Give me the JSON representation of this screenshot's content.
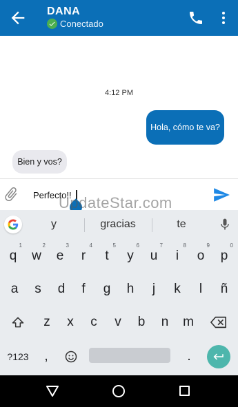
{
  "header": {
    "contact_name": "DANA",
    "status": "Conectado",
    "icons": [
      "back-arrow-icon",
      "phone-icon",
      "more-vertical-icon",
      "check-circle-icon"
    ],
    "bar_color": "#0b6fb7"
  },
  "chat": {
    "timestamp": "4:12 PM",
    "messages": [
      {
        "direction": "outgoing",
        "text": "Hola, cómo te va?"
      },
      {
        "direction": "incoming",
        "text": "Bien y vos?"
      }
    ]
  },
  "composer": {
    "value": "Perfecto!!",
    "icons": [
      "paperclip-icon",
      "send-icon"
    ]
  },
  "watermark": "UpdateStar.com",
  "keyboard": {
    "suggestions": [
      "y",
      "gracias",
      "te"
    ],
    "row1": [
      {
        "key": "q",
        "hint": "1"
      },
      {
        "key": "w",
        "hint": "2"
      },
      {
        "key": "e",
        "hint": "3"
      },
      {
        "key": "r",
        "hint": "4"
      },
      {
        "key": "t",
        "hint": "5"
      },
      {
        "key": "y",
        "hint": "6"
      },
      {
        "key": "u",
        "hint": "7"
      },
      {
        "key": "i",
        "hint": "8"
      },
      {
        "key": "o",
        "hint": "9"
      },
      {
        "key": "p",
        "hint": "0"
      }
    ],
    "row2": [
      "a",
      "s",
      "d",
      "f",
      "g",
      "h",
      "j",
      "k",
      "l",
      "ñ"
    ],
    "row3": [
      "z",
      "x",
      "c",
      "v",
      "b",
      "n",
      "m"
    ],
    "row4": {
      "symbols": "?123",
      "comma": ",",
      "period": "."
    },
    "icons": [
      "google-g-icon",
      "microphone-icon",
      "shift-icon",
      "backspace-icon",
      "emoji-icon",
      "enter-icon"
    ],
    "enter_color": "#4db6ac"
  },
  "navbar": {
    "icons": [
      "nav-back-icon",
      "nav-home-icon",
      "nav-recent-icon"
    ]
  }
}
